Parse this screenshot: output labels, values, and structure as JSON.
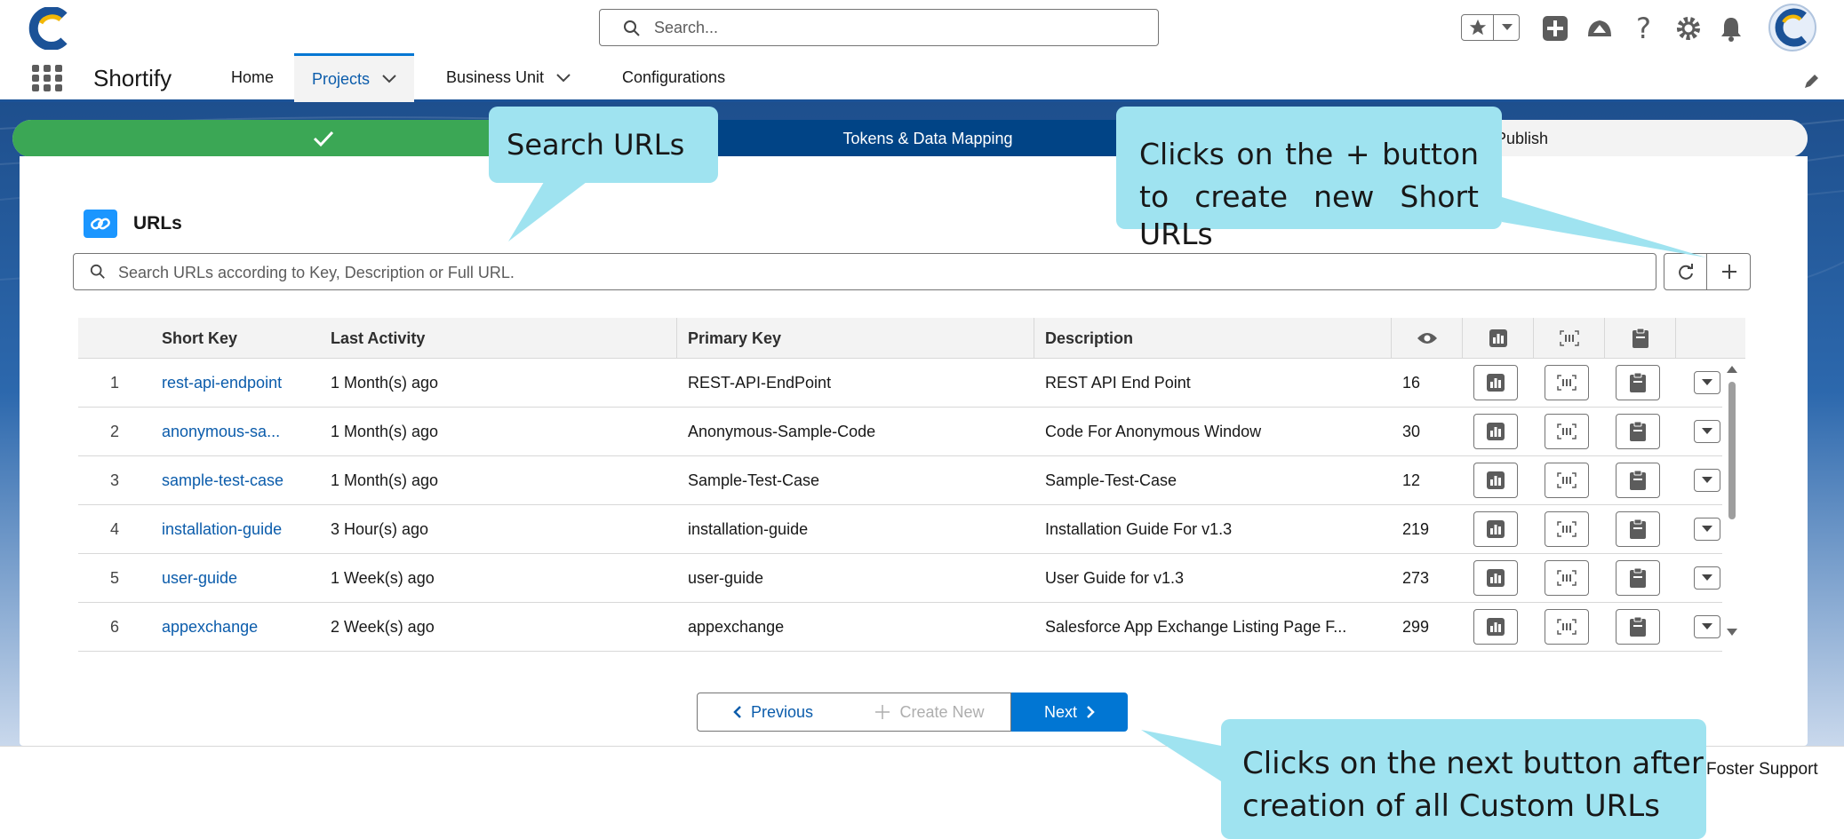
{
  "header": {
    "search_placeholder": "Search..."
  },
  "app": {
    "name": "Shortify",
    "nav": [
      {
        "label": "Home"
      },
      {
        "label": "Projects"
      },
      {
        "label": "Business Unit"
      },
      {
        "label": "Configurations"
      }
    ]
  },
  "path": {
    "steps": [
      {
        "label": "",
        "state": "complete"
      },
      {
        "label": "Tokens & Data Mapping",
        "state": "current"
      },
      {
        "label": "& Publish",
        "state": "incomplete"
      }
    ]
  },
  "card": {
    "title": "URLs",
    "search_placeholder": "Search URLs according to Key, Description or Full URL."
  },
  "table": {
    "columns": [
      "Short Key",
      "Last Activity",
      "Primary Key",
      "Description"
    ],
    "rows": [
      {
        "n": "1",
        "short_key": "rest-api-endpoint",
        "last_activity": "1 Month(s) ago",
        "primary_key": "REST-API-EndPoint",
        "description": "REST API End Point",
        "views": "16"
      },
      {
        "n": "2",
        "short_key": "anonymous-sa...",
        "last_activity": "1 Month(s) ago",
        "primary_key": "Anonymous-Sample-Code",
        "description": "Code For Anonymous Window",
        "views": "30"
      },
      {
        "n": "3",
        "short_key": "sample-test-case",
        "last_activity": "1 Month(s) ago",
        "primary_key": "Sample-Test-Case",
        "description": "Sample-Test-Case",
        "views": "12"
      },
      {
        "n": "4",
        "short_key": "installation-guide",
        "last_activity": "3 Hour(s) ago",
        "primary_key": "installation-guide",
        "description": "Installation Guide For v1.3",
        "views": "219"
      },
      {
        "n": "5",
        "short_key": "user-guide",
        "last_activity": "1 Week(s) ago",
        "primary_key": "user-guide",
        "description": "User Guide for v1.3",
        "views": "273"
      },
      {
        "n": "6",
        "short_key": "appexchange",
        "last_activity": "2 Week(s) ago",
        "primary_key": "appexchange",
        "description": "Salesforce App Exchange Listing Page F...",
        "views": "299"
      }
    ]
  },
  "pager": {
    "previous": "Previous",
    "create_new": "Create New",
    "next": "Next"
  },
  "footer": {
    "text": "Foster Support"
  },
  "callouts": {
    "search": "Search URLs",
    "plus_line1": "Clicks on the + button",
    "plus_line2": "to create new Short",
    "plus_line3": "URLs",
    "next_line1": "Clicks on the next button after",
    "next_line2": "creation of all Custom URLs"
  },
  "colors": {
    "brand_blue": "#0176d3",
    "path_complete": "#3ba755",
    "path_current": "#014486",
    "callout": "#9fe3f0",
    "link": "#0b5cab"
  }
}
